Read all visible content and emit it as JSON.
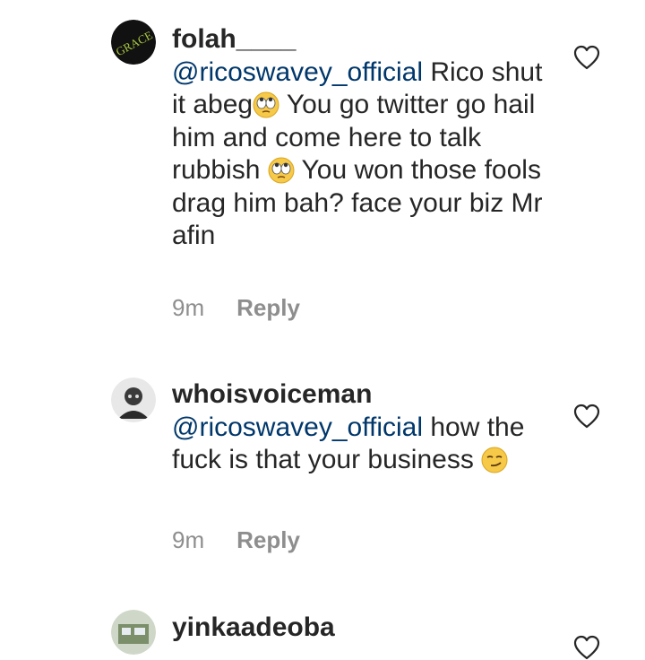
{
  "comments": [
    {
      "username": "folah____",
      "mention": "@ricoswavey_official",
      "parts": [
        " Rico shut it abeg",
        " You go twitter go hail him and come here to talk rubbish ",
        " You won those fools drag him bah? face your biz Mr afin"
      ],
      "emojis": [
        "eye-roll-emoji",
        "eye-roll-emoji"
      ],
      "avatar_text": "GRACE",
      "time": "9m",
      "reply_label": "Reply",
      "like_icon": "heart-outline-icon"
    },
    {
      "username": "whoisvoiceman",
      "mention": "@ricoswavey_official",
      "parts": [
        " how the fuck is that your business "
      ],
      "emojis": [
        "smirk-emoji"
      ],
      "time": "9m",
      "reply_label": "Reply",
      "like_icon": "heart-outline-icon"
    },
    {
      "username": "yinkaadeoba",
      "like_icon": "heart-outline-icon"
    }
  ],
  "colors": {
    "text": "#262626",
    "mention": "#00376b",
    "meta": "#8e8e8e",
    "emoji_yellow": "#f7c948"
  }
}
